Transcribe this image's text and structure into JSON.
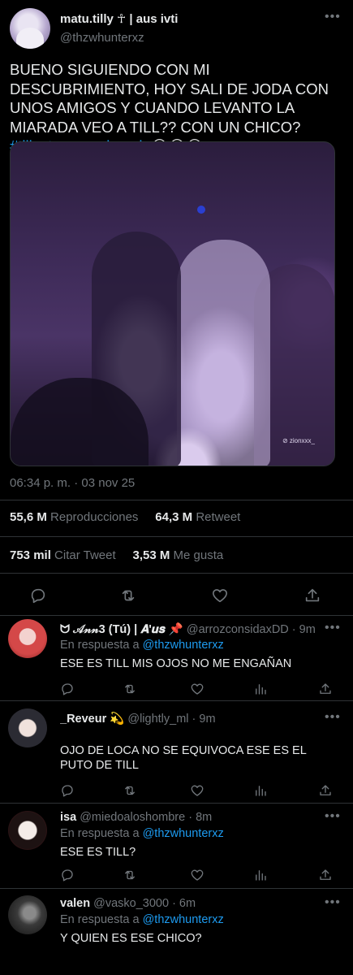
{
  "main_tweet": {
    "display_name": "matu.tilly ☥ | aus ivti",
    "handle": "@thzwhunterxz",
    "text": "BUENO SIGUIENDO CON MI DESCUBRIMIENTO, HOY SALI DE JODA CON UNOS AMIGOS Y CUANDO LEVANTO LA MIARADA VEO A TILL?? CON UN CHICO? ",
    "hashtag": "#tillyotengomejorcola",
    "emoji": "😭😭😭",
    "image_watermark": "⊘ zionxxx_",
    "timestamp": "06:34 p. m. · 03 nov 25",
    "views_count": "55,6 M",
    "views_label": "Reproducciones",
    "retweets_count": "64,3 M",
    "retweets_label": "Retweet",
    "quotes_count": "753 mil",
    "quotes_label": "Citar Tweet",
    "likes_count": "3,53 M",
    "likes_label": "Me gusta"
  },
  "replies": [
    {
      "display_name": "ᗢ 𝒜𝓃𝓃3 (Tú) | 𝑨'𝒖𝒔 📌",
      "handle": "@arrozconsidaxDD · 9m",
      "reply_prefix": "En respuesta a ",
      "reply_to": "@thzwhunterxz",
      "text": "ESE ES TILL MIS OJOS NO ME ENGAÑAN",
      "avatar_color": "#c23a3a"
    },
    {
      "display_name": "_Reveur 💫",
      "handle": "@lightly_ml · 9m",
      "text": "OJO DE LOCA NO SE EQUIVOCA ESE ES EL PUTO DE TILL",
      "avatar_color": "#2b2b33"
    },
    {
      "display_name": "isa",
      "handle": "@miedoaloshombre · 8m",
      "reply_prefix": "En respuesta a ",
      "reply_to": "@thzwhunterxz",
      "text": "ESE ES TILL?",
      "avatar_color": "#8a1f24"
    },
    {
      "display_name": "valen",
      "handle": "@vasko_3000 · 6m",
      "reply_prefix": "En respuesta a ",
      "reply_to": "@thzwhunterxz",
      "text": "Y QUIEN ES ESE CHICO?",
      "avatar_color": "#3a3a3a"
    }
  ],
  "icons": [
    "more-icon",
    "reply-icon",
    "retweet-icon",
    "like-icon",
    "share-icon",
    "views-icon"
  ],
  "colors": {
    "accent": "#1d9bf0",
    "muted": "#71767b",
    "text": "#e7e9ea",
    "divider": "#2f3336"
  }
}
